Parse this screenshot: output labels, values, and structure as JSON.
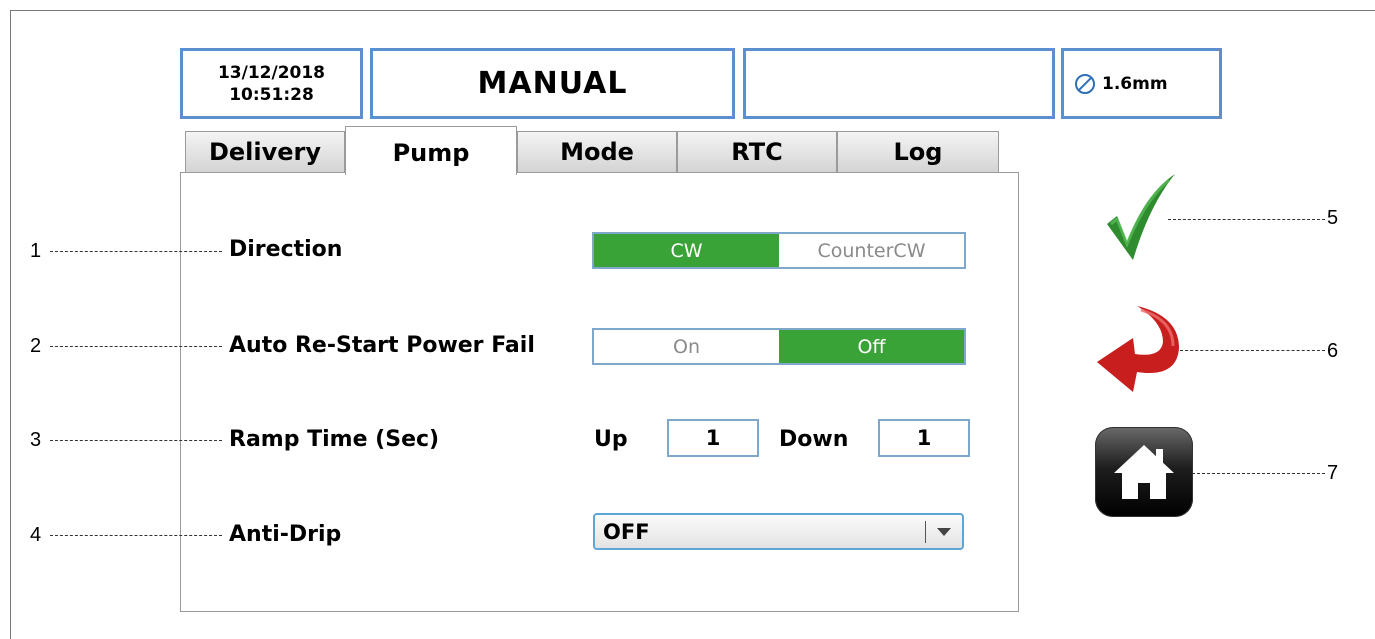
{
  "header": {
    "date": "13/12/2018",
    "time": "10:51:28",
    "mode": "MANUAL",
    "message": "",
    "nozzle_size": "1.6mm"
  },
  "tabs": [
    {
      "label": "Delivery",
      "active": false
    },
    {
      "label": "Pump",
      "active": true
    },
    {
      "label": "Mode",
      "active": false
    },
    {
      "label": "RTC",
      "active": false
    },
    {
      "label": "Log",
      "active": false
    }
  ],
  "pump": {
    "direction": {
      "label": "Direction",
      "options": [
        "CW",
        "CounterCW"
      ],
      "selected": "CW"
    },
    "auto_restart": {
      "label": "Auto Re-Start Power Fail",
      "options": [
        "On",
        "Off"
      ],
      "selected": "Off"
    },
    "ramp_time": {
      "label": "Ramp Time (Sec)",
      "up_label": "Up",
      "up_value": "1",
      "down_label": "Down",
      "down_value": "1"
    },
    "anti_drip": {
      "label": "Anti-Drip",
      "value": "OFF"
    }
  },
  "callouts": [
    "1",
    "2",
    "3",
    "4",
    "5",
    "6",
    "7"
  ],
  "icons": {
    "nozzle": "no-symbol-icon",
    "confirm": "check-mark-icon",
    "back": "curved-back-arrow-icon",
    "home": "home-icon",
    "dropdown": "caret-down-icon"
  },
  "colors": {
    "accent_border": "#5b8fcf",
    "selected_green": "#3aa338",
    "check_green": "#2e8b2e",
    "back_red": "#c81e1e"
  }
}
